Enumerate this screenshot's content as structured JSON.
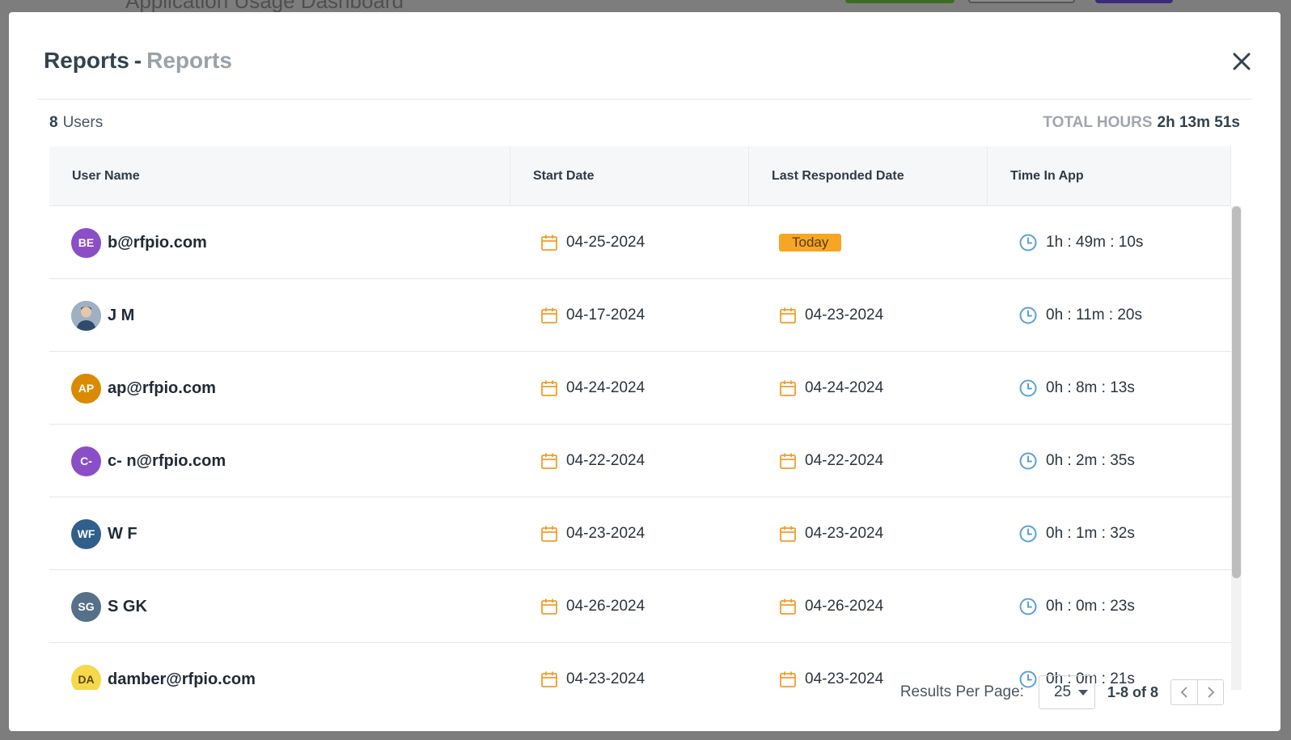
{
  "background": {
    "title": "Application Usage Dashboard"
  },
  "modal": {
    "title": "Reports",
    "separator": "-",
    "subtitle": "Reports",
    "close_icon": "close-icon"
  },
  "summary": {
    "user_count": "8",
    "users_label": "Users",
    "total_hours_label": "TOTAL HOURS",
    "total_hours_value": "2h 13m 51s"
  },
  "table": {
    "columns": [
      "User Name",
      "Start Date",
      "Last Responded Date",
      "Time In App"
    ],
    "rows": [
      {
        "initials": "BE",
        "avatar_color": "#8a4fc7",
        "name": "b@rfpio.com",
        "start": "04-25-2024",
        "last": "Today",
        "last_is_badge": true,
        "time": "1h : 49m : 10s"
      },
      {
        "initials": "",
        "avatar_color": "#a9b4c2",
        "photo": true,
        "name": "J M",
        "start": "04-17-2024",
        "last": "04-23-2024",
        "time": "0h : 11m : 20s"
      },
      {
        "initials": "AP",
        "avatar_color": "#d98a00",
        "name": "ap@rfpio.com",
        "start": "04-24-2024",
        "last": "04-24-2024",
        "time": "0h : 8m : 13s"
      },
      {
        "initials": "C-",
        "avatar_color": "#8a4fc7",
        "name": "c- n@rfpio.com",
        "start": "04-22-2024",
        "last": "04-22-2024",
        "time": "0h : 2m : 35s"
      },
      {
        "initials": "WF",
        "avatar_color": "#2f5f8a",
        "name": "W F",
        "start": "04-23-2024",
        "last": "04-23-2024",
        "time": "0h : 1m : 32s"
      },
      {
        "initials": "SG",
        "avatar_color": "#557088",
        "name": "S GK",
        "start": "04-26-2024",
        "last": "04-26-2024",
        "time": "0h : 0m : 23s"
      },
      {
        "initials": "DA",
        "avatar_color": "#f5d94a",
        "name": "damber@rfpio.com",
        "start": "04-23-2024",
        "last": "04-23-2024",
        "time": "0h : 0m : 21s"
      }
    ]
  },
  "colors": {
    "calendar_icon": "#f39c2b",
    "clock_icon": "#5aa0dc",
    "today_badge": "#f6a623"
  },
  "footer": {
    "results_per_page_label": "Results Per Page:",
    "results_per_page_value": "25",
    "range_text": "1-8 of 8"
  }
}
